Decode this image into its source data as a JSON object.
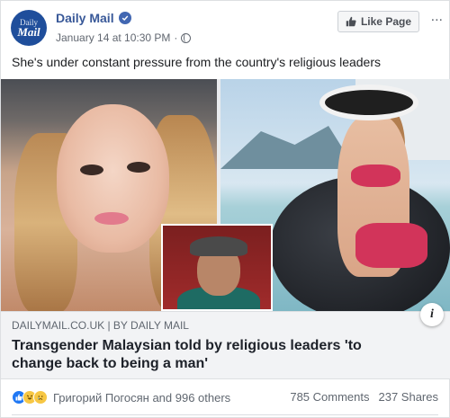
{
  "header": {
    "avatar_line1": "Daily",
    "avatar_line2": "Mail",
    "page_name": "Daily Mail",
    "timestamp": "January 14 at 10:30 PM",
    "separator": "·",
    "like_page_label": "Like Page",
    "more_label": "..."
  },
  "post": {
    "caption": "She's under constant pressure from the country's religious leaders"
  },
  "link_preview": {
    "source": "DAILYMAIL.CO.UK | BY DAILY MAIL",
    "title": "Transgender Malaysian told by religious leaders 'to change back to being a man'",
    "info_label": "i"
  },
  "footer": {
    "reaction_icons": [
      "like-icon",
      "haha-icon",
      "sad-icon"
    ],
    "reaction_names": "Григорий Погосян and 996 others",
    "comments": "785 Comments",
    "shares": "237 Shares"
  },
  "colors": {
    "brand_blue": "#385898",
    "like_blue": "#2078f4",
    "avatar_bg": "#1f4e9b"
  }
}
